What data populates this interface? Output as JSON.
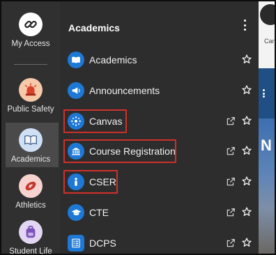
{
  "rail": {
    "items": [
      {
        "label": "My Access",
        "icon": "link-icon"
      },
      {
        "label": "Public Safety",
        "icon": "siren-icon"
      },
      {
        "label": "Academics",
        "icon": "book-icon",
        "selected": true
      },
      {
        "label": "Athletics",
        "icon": "football-icon"
      },
      {
        "label": "Student Life",
        "icon": "backpack-icon"
      }
    ]
  },
  "panel": {
    "title": "Academics",
    "items": [
      {
        "label": "Academics",
        "icon": "book-open-icon",
        "external": false,
        "highlighted": false
      },
      {
        "label": "Announcements",
        "icon": "megaphone-icon",
        "external": false,
        "highlighted": false
      },
      {
        "label": "Canvas",
        "icon": "canvas-logo-icon",
        "external": true,
        "highlighted": true
      },
      {
        "label": "Course Registration",
        "icon": "institution-icon",
        "external": true,
        "highlighted": true
      },
      {
        "label": "CSER",
        "icon": "person-icon",
        "external": true,
        "highlighted": true
      },
      {
        "label": "CTE",
        "icon": "graduation-cap-icon",
        "external": true,
        "highlighted": false
      },
      {
        "label": "DCPS",
        "icon": "document-list-icon",
        "external": true,
        "highlighted": false
      }
    ]
  },
  "underlying": {
    "partial_tab_label": "Car",
    "partial_heading": "N"
  },
  "colors": {
    "highlight": "#d0302a",
    "icon_blue": "#1e78d6"
  }
}
